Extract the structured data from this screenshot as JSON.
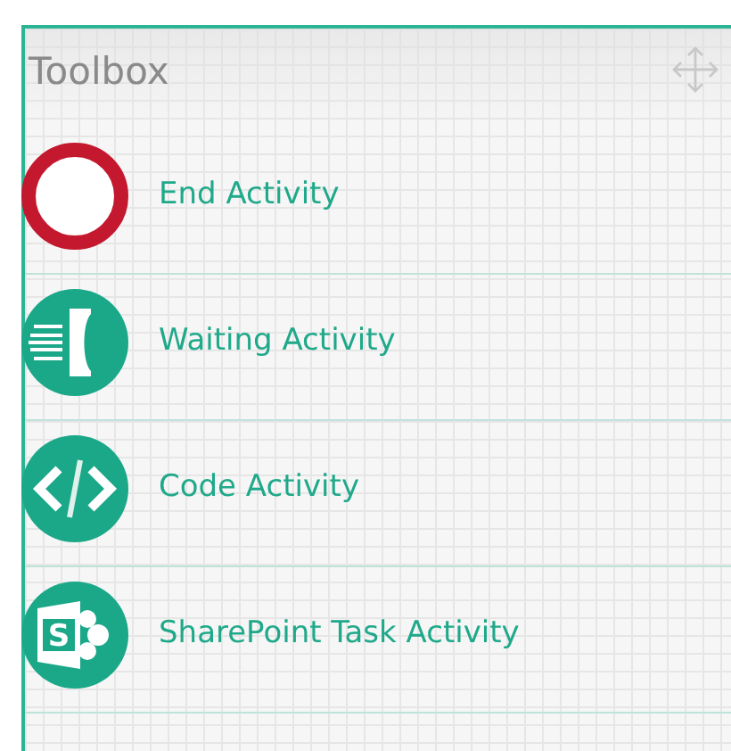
{
  "panel": {
    "title": "Toolbox"
  },
  "items": [
    {
      "kind": "end",
      "label": "End Activity"
    },
    {
      "kind": "waiting",
      "label": "Waiting Activity"
    },
    {
      "kind": "code",
      "label": "Code Activity"
    },
    {
      "kind": "sharepoint",
      "label": "SharePoint Task Activity",
      "icon_text": "S"
    }
  ]
}
